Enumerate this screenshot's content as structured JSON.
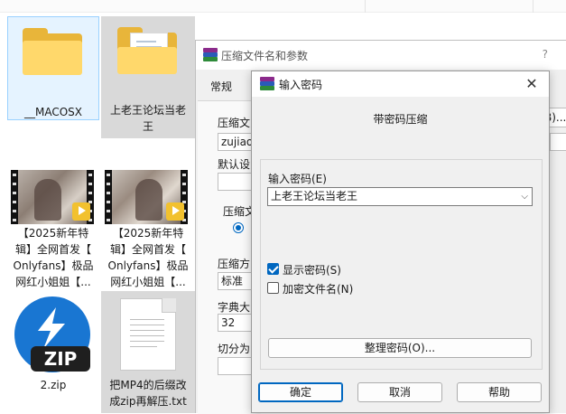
{
  "explorer": {
    "items": [
      {
        "label": "__MACOSX"
      },
      {
        "label": "上老王论坛当老王"
      },
      {
        "label": "【2025新年特辑】全网首发【Onlyfans】极品网红小姐姐【..."
      },
      {
        "label": "【2025新年特辑】全网首发【Onlyfans】极品网红小姐姐【..."
      },
      {
        "label": "2.zip"
      },
      {
        "label": "把MP4的后缀改成zip再解压.txt"
      }
    ],
    "item_lines": {
      "macosx": "__MACOSX",
      "folder2": [
        "上老王论坛当老",
        "王"
      ],
      "video": [
        "【2025新年特",
        "辑】全网首发【",
        "Onlyfans】极品",
        "网红小姐姐【..."
      ],
      "zip": "2.zip",
      "txt": [
        "把MP4的后缀改",
        "成zip再解压.txt"
      ]
    },
    "zip_badge": "ZIP",
    "player_badge": "Player"
  },
  "archive_dialog": {
    "title": "压缩文件名和参数",
    "help": "?",
    "tab_general": "常规",
    "archive_name_label": "压缩文",
    "archive_name_value": "zujiaoc",
    "default_label": "默认设",
    "format_label": "压缩文",
    "method_label": "压缩方",
    "method_value": "标准",
    "dict_label": "字典大",
    "dict_value": "32",
    "split_label": "切分为",
    "browse_fragment": "B)..."
  },
  "password_dialog": {
    "title": "输入密码",
    "close": "✕",
    "heading": "带密码压缩",
    "password_label": "输入密码(E)",
    "password_value": "上老王论坛当老王",
    "show_password_label": "显示密码(S)",
    "show_password_checked": true,
    "encrypt_names_label": "加密文件名(N)",
    "encrypt_names_checked": false,
    "organize_button": "整理密码(O)...",
    "ok_button": "确定",
    "cancel_button": "取消",
    "help_button": "帮助"
  },
  "colors": {
    "accent": "#0067c0",
    "folder_yellow": "#ffd86b",
    "zip_blue": "#1976d2"
  }
}
